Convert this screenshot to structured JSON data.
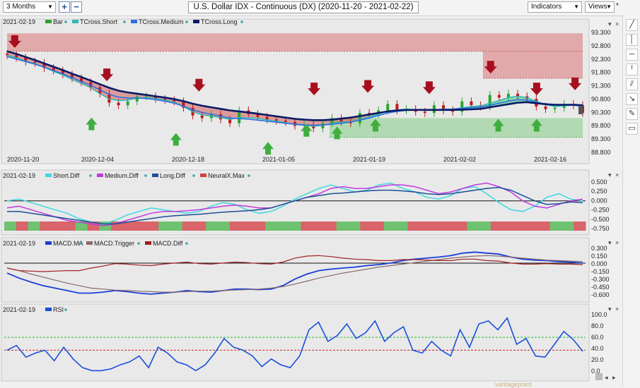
{
  "toolbar": {
    "period": "3 Months",
    "zoom_in": "+",
    "zoom_out": "−",
    "title": "U.S. Dollar IDX - Continuous (DX) (2020-11-20 - 2021-02-22)",
    "indicators": "Indicators",
    "views": "Views",
    "star": "*"
  },
  "watermark": "vantagepoint",
  "chart_data": [
    {
      "id": "price",
      "type": "candlestick",
      "legend_date": "2021-02-19",
      "legend": [
        {
          "name": "Bar",
          "color": "#2e9e2e"
        },
        {
          "name": "TCross.Short",
          "color": "#2ab8b0"
        },
        {
          "name": "TCross.Medium",
          "color": "#2d6fe0"
        },
        {
          "name": "TCross.Long",
          "color": "#0a1a66"
        }
      ],
      "ylim": [
        88.6,
        93.6
      ],
      "yticks": [
        "93.300",
        "92.800",
        "92.300",
        "91.800",
        "91.300",
        "90.800",
        "90.300",
        "89.800",
        "89.300",
        "88.800"
      ],
      "xlabels": [
        "2020-11-20",
        "2020-12-04",
        "2020-12-18",
        "2021-01-05",
        "2021-01-19",
        "2021-02-02",
        "2021-02-16"
      ],
      "bars_count": 63,
      "close": [
        92.55,
        92.45,
        92.3,
        92.25,
        92.05,
        91.95,
        91.8,
        91.65,
        91.5,
        91.3,
        91.05,
        90.7,
        90.6,
        90.75,
        90.95,
        90.95,
        90.85,
        90.8,
        90.75,
        90.5,
        90.2,
        90.1,
        90.25,
        90.05,
        89.9,
        90.4,
        90.25,
        90.15,
        90.05,
        90.0,
        89.95,
        89.8,
        89.85,
        89.7,
        89.9,
        90.1,
        89.95,
        89.9,
        90.3,
        90.25,
        90.4,
        90.65,
        90.4,
        90.45,
        90.35,
        90.3,
        90.6,
        90.4,
        90.35,
        90.75,
        90.6,
        90.55,
        91.0,
        90.9,
        91.05,
        90.95,
        90.85,
        90.55,
        90.45,
        90.5,
        90.65,
        90.6,
        90.3
      ],
      "tcross_short": [
        92.55,
        92.45,
        92.32,
        92.22,
        92.08,
        91.92,
        91.78,
        91.6,
        91.45,
        91.28,
        91.05,
        90.85,
        90.78,
        90.8,
        90.88,
        90.9,
        90.86,
        90.8,
        90.72,
        90.55,
        90.35,
        90.22,
        90.18,
        90.12,
        90.05,
        90.12,
        90.12,
        90.08,
        90.03,
        89.98,
        89.92,
        89.85,
        89.82,
        89.78,
        89.82,
        89.9,
        89.95,
        89.95,
        90.05,
        90.15,
        90.25,
        90.38,
        90.42,
        90.45,
        90.43,
        90.4,
        90.42,
        90.45,
        90.44,
        90.5,
        90.55,
        90.58,
        90.68,
        90.78,
        90.9,
        90.95,
        90.9,
        90.75,
        90.62,
        90.55,
        90.58,
        90.6,
        90.55
      ],
      "tcross_medium": [
        92.5,
        92.4,
        92.3,
        92.2,
        92.08,
        91.95,
        91.82,
        91.68,
        91.52,
        91.38,
        91.2,
        91.02,
        90.92,
        90.88,
        90.88,
        90.86,
        90.82,
        90.76,
        90.68,
        90.56,
        90.42,
        90.32,
        90.25,
        90.18,
        90.1,
        90.08,
        90.06,
        90.02,
        89.98,
        89.94,
        89.9,
        89.86,
        89.84,
        89.82,
        89.83,
        89.86,
        89.9,
        89.95,
        90.02,
        90.1,
        90.2,
        90.3,
        90.36,
        90.4,
        90.41,
        90.42,
        90.43,
        90.44,
        90.45,
        90.48,
        90.5,
        90.53,
        90.6,
        90.68,
        90.76,
        90.82,
        90.8,
        90.72,
        90.65,
        90.6,
        90.6,
        90.6,
        90.58
      ],
      "tcross_long": [
        92.7,
        92.6,
        92.48,
        92.36,
        92.23,
        92.1,
        91.97,
        91.83,
        91.7,
        91.56,
        91.42,
        91.28,
        91.17,
        91.1,
        91.05,
        91.0,
        90.95,
        90.9,
        90.84,
        90.76,
        90.66,
        90.58,
        90.52,
        90.46,
        90.4,
        90.36,
        90.32,
        90.27,
        90.22,
        90.17,
        90.12,
        90.07,
        90.04,
        90.02,
        90.02,
        90.04,
        90.08,
        90.12,
        90.18,
        90.24,
        90.3,
        90.36,
        90.4,
        90.42,
        90.42,
        90.42,
        90.42,
        90.42,
        90.42,
        90.43,
        90.44,
        90.46,
        90.52,
        90.58,
        90.64,
        90.7,
        90.72,
        90.68,
        90.64,
        90.62,
        90.62,
        90.62,
        90.6
      ],
      "down_arrows": [
        {
          "i": 1,
          "price": 93.0
        },
        {
          "i": 13,
          "price": 91.7
        },
        {
          "i": 25,
          "price": 91.3
        },
        {
          "i": 40,
          "price": 91.15
        },
        {
          "i": 47,
          "price": 91.25
        },
        {
          "i": 55,
          "price": 91.2
        },
        {
          "i": 63,
          "price": 92.0
        },
        {
          "i": 69,
          "price": 91.15
        },
        {
          "i": 74,
          "price": 91.35
        }
      ],
      "up_arrows": [
        {
          "i": 11,
          "price": 89.9
        },
        {
          "i": 22,
          "price": 89.3
        },
        {
          "i": 34,
          "price": 88.95
        },
        {
          "i": 39,
          "price": 89.65
        },
        {
          "i": 43,
          "price": 89.55
        },
        {
          "i": 48,
          "price": 89.85
        },
        {
          "i": 64,
          "price": 89.85
        },
        {
          "i": 69,
          "price": 89.85
        }
      ],
      "zones": [
        {
          "type": "resistance",
          "from": 0,
          "to": 75,
          "top": 93.4,
          "bottom": 92.7
        },
        {
          "type": "resistance",
          "from": 62,
          "to": 75,
          "top": 92.7,
          "bottom": 91.65
        },
        {
          "type": "support",
          "from": 42,
          "to": 75,
          "top": 90.1,
          "bottom": 89.35
        }
      ]
    },
    {
      "id": "neuralx",
      "type": "line",
      "legend_date": "2021-02-19",
      "legend": [
        {
          "name": "Short.Diff",
          "color": "#3fd8e0"
        },
        {
          "name": "Medium.Diff",
          "color": "#c03ae0"
        },
        {
          "name": "Long.Diff",
          "color": "#1d4f94"
        },
        {
          "name": "NeuralX.Max",
          "color": "#d04040"
        }
      ],
      "ylim": [
        -0.9,
        0.65
      ],
      "yticks": [
        "0.500",
        "0.250",
        "0.000",
        "-0.250",
        "-0.500",
        "-0.750"
      ],
      "series": [
        {
          "name": "Short.Diff",
          "values": [
            0.0,
            0.05,
            -0.05,
            -0.15,
            -0.25,
            -0.35,
            -0.5,
            -0.6,
            -0.65,
            -0.55,
            -0.4,
            -0.3,
            -0.2,
            -0.25,
            -0.3,
            -0.35,
            -0.3,
            -0.15,
            -0.05,
            -0.1,
            -0.25,
            -0.35,
            -0.3,
            -0.15,
            0.05,
            0.2,
            0.35,
            0.45,
            0.35,
            0.25,
            0.3,
            0.45,
            0.5,
            0.35,
            0.25,
            0.1,
            0.05,
            0.15,
            0.35,
            0.4,
            0.2,
            -0.05,
            -0.25,
            -0.3,
            -0.15,
            0.1,
            0.2,
            0.05,
            0.0
          ]
        },
        {
          "name": "Medium.Diff",
          "values": [
            -0.2,
            -0.15,
            -0.25,
            -0.35,
            -0.45,
            -0.55,
            -0.6,
            -0.65,
            -0.7,
            -0.65,
            -0.55,
            -0.45,
            -0.35,
            -0.3,
            -0.3,
            -0.28,
            -0.25,
            -0.2,
            -0.15,
            -0.12,
            -0.15,
            -0.2,
            -0.2,
            -0.1,
            0.0,
            0.1,
            0.2,
            0.35,
            0.4,
            0.35,
            0.35,
            0.4,
            0.45,
            0.45,
            0.4,
            0.3,
            0.2,
            0.25,
            0.35,
            0.45,
            0.5,
            0.4,
            0.25,
            0.0,
            -0.15,
            -0.2,
            -0.1,
            0.0,
            0.05
          ]
        },
        {
          "name": "Long.Diff",
          "values": [
            -0.3,
            -0.3,
            -0.35,
            -0.4,
            -0.45,
            -0.5,
            -0.55,
            -0.6,
            -0.65,
            -0.65,
            -0.6,
            -0.55,
            -0.5,
            -0.45,
            -0.42,
            -0.4,
            -0.38,
            -0.35,
            -0.32,
            -0.3,
            -0.28,
            -0.25,
            -0.2,
            -0.1,
            0.0,
            0.1,
            0.15,
            0.2,
            0.22,
            0.25,
            0.28,
            0.3,
            0.3,
            0.28,
            0.25,
            0.2,
            0.18,
            0.2,
            0.25,
            0.3,
            0.35,
            0.38,
            0.3,
            0.15,
            0.0,
            -0.1,
            -0.08,
            -0.03,
            -0.05
          ]
        }
      ],
      "neuralx_max": [
        "up",
        "down",
        "up",
        "down",
        "down",
        "down",
        "up",
        "down",
        "up",
        "down",
        "down",
        "down",
        "down",
        "up",
        "up",
        "down",
        "down",
        "up",
        "up",
        "down",
        "down",
        "down",
        "up",
        "up",
        "up",
        "down",
        "down",
        "down",
        "up",
        "up",
        "down",
        "down",
        "up",
        "up",
        "down",
        "down",
        "down",
        "down",
        "down",
        "up",
        "up",
        "down",
        "down",
        "down",
        "down",
        "down",
        "up",
        "up",
        "down"
      ]
    },
    {
      "id": "macd",
      "type": "line",
      "legend_date": "2021-02-19",
      "legend": [
        {
          "name": "MACD.MA",
          "color": "#1a3ed8"
        },
        {
          "name": "MACD.Trigger",
          "color": "#8a6a6a"
        },
        {
          "name": "MACD.Diff",
          "color": "#a02020"
        }
      ],
      "ylim": [
        -0.72,
        0.38
      ],
      "yticks": [
        "0.300",
        "0.150",
        "0.000",
        "-0.150",
        "-0.300",
        "-0.450",
        "-0.600"
      ],
      "series": [
        {
          "name": "MACD.MA",
          "values": [
            -0.2,
            -0.3,
            -0.38,
            -0.45,
            -0.5,
            -0.55,
            -0.6,
            -0.6,
            -0.58,
            -0.55,
            -0.57,
            -0.6,
            -0.62,
            -0.6,
            -0.58,
            -0.55,
            -0.57,
            -0.58,
            -0.55,
            -0.52,
            -0.52,
            -0.53,
            -0.52,
            -0.45,
            -0.32,
            -0.22,
            -0.15,
            -0.12,
            -0.1,
            -0.08,
            -0.05,
            -0.03,
            0.0,
            0.05,
            0.08,
            0.1,
            0.12,
            0.15,
            0.2,
            0.22,
            0.2,
            0.18,
            0.12,
            0.08,
            0.06,
            0.05,
            0.03,
            0.02,
            0.0
          ]
        },
        {
          "name": "MACD.Trigger",
          "values": [
            -0.1,
            -0.15,
            -0.22,
            -0.28,
            -0.34,
            -0.4,
            -0.45,
            -0.5,
            -0.52,
            -0.54,
            -0.55,
            -0.56,
            -0.57,
            -0.58,
            -0.58,
            -0.57,
            -0.56,
            -0.56,
            -0.55,
            -0.54,
            -0.53,
            -0.52,
            -0.5,
            -0.47,
            -0.42,
            -0.36,
            -0.3,
            -0.25,
            -0.2,
            -0.16,
            -0.12,
            -0.08,
            -0.05,
            -0.02,
            0.01,
            0.04,
            0.07,
            0.1,
            0.12,
            0.14,
            0.15,
            0.14,
            0.12,
            0.1,
            0.08,
            0.06,
            0.05,
            0.04,
            0.03
          ]
        },
        {
          "name": "MACD.Diff",
          "values": [
            -0.1,
            -0.15,
            -0.16,
            -0.17,
            -0.16,
            -0.15,
            -0.15,
            -0.1,
            -0.06,
            -0.01,
            -0.02,
            -0.04,
            -0.05,
            -0.02,
            0.0,
            0.02,
            -0.01,
            -0.02,
            0.0,
            0.02,
            0.01,
            -0.01,
            -0.02,
            0.02,
            0.1,
            0.14,
            0.15,
            0.13,
            0.1,
            0.08,
            0.07,
            0.05,
            0.05,
            0.07,
            0.07,
            0.06,
            0.05,
            0.05,
            0.08,
            0.08,
            0.05,
            0.04,
            0.0,
            -0.02,
            -0.02,
            -0.01,
            -0.02,
            -0.02,
            -0.03
          ]
        }
      ]
    },
    {
      "id": "rsi",
      "type": "line",
      "legend_date": "2021-02-19",
      "legend": [
        {
          "name": "RSI",
          "color": "#1a4fd8"
        }
      ],
      "ylim": [
        -3,
        108
      ],
      "yticks": [
        "100.0",
        "80.0",
        "60.0",
        "40.0",
        "20.0",
        "0.0"
      ],
      "overbought": 62,
      "oversold": 40,
      "series": [
        {
          "name": "RSI",
          "values": [
            40,
            48,
            28,
            35,
            40,
            22,
            45,
            25,
            10,
            5,
            5,
            8,
            15,
            20,
            30,
            10,
            45,
            35,
            20,
            15,
            5,
            15,
            35,
            60,
            45,
            40,
            30,
            12,
            25,
            15,
            10,
            30,
            75,
            88,
            55,
            65,
            85,
            60,
            70,
            90,
            55,
            70,
            80,
            40,
            35,
            55,
            40,
            30,
            75,
            45,
            85,
            90,
            75,
            95,
            50,
            60,
            30,
            28,
            50,
            72,
            58,
            38
          ]
        }
      ]
    }
  ]
}
